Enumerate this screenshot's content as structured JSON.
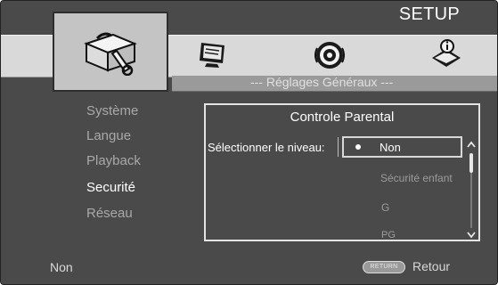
{
  "header": {
    "title": "SETUP"
  },
  "tabs": [
    {
      "name": "general-settings",
      "icon": "toolbox-icon",
      "active": true
    },
    {
      "name": "display",
      "icon": "monitor-icon",
      "active": false
    },
    {
      "name": "audio",
      "icon": "speaker-icon",
      "active": false
    },
    {
      "name": "information",
      "icon": "info-book-icon",
      "active": false
    }
  ],
  "subtitle": "--- Réglages Généraux ---",
  "menu": {
    "items": [
      {
        "label": "Système"
      },
      {
        "label": "Langue"
      },
      {
        "label": "Playback"
      },
      {
        "label": "Securité",
        "selected": true
      },
      {
        "label": "Réseau"
      }
    ]
  },
  "panel": {
    "title": "Controle Parental",
    "level_label": "Sélectionner le niveau:",
    "options": [
      {
        "label": "Non",
        "selected": true
      },
      {
        "label": "Sécurité enfant"
      },
      {
        "label": "G"
      },
      {
        "label": "PG"
      }
    ]
  },
  "footer": {
    "status": "Non",
    "return_key": "RETURN",
    "return_label": "Retour"
  },
  "colors": {
    "background": "#4a4a4a",
    "band": "#d9d9d9",
    "selected_text": "#ffffff",
    "dim_text": "#a9a9a9"
  }
}
